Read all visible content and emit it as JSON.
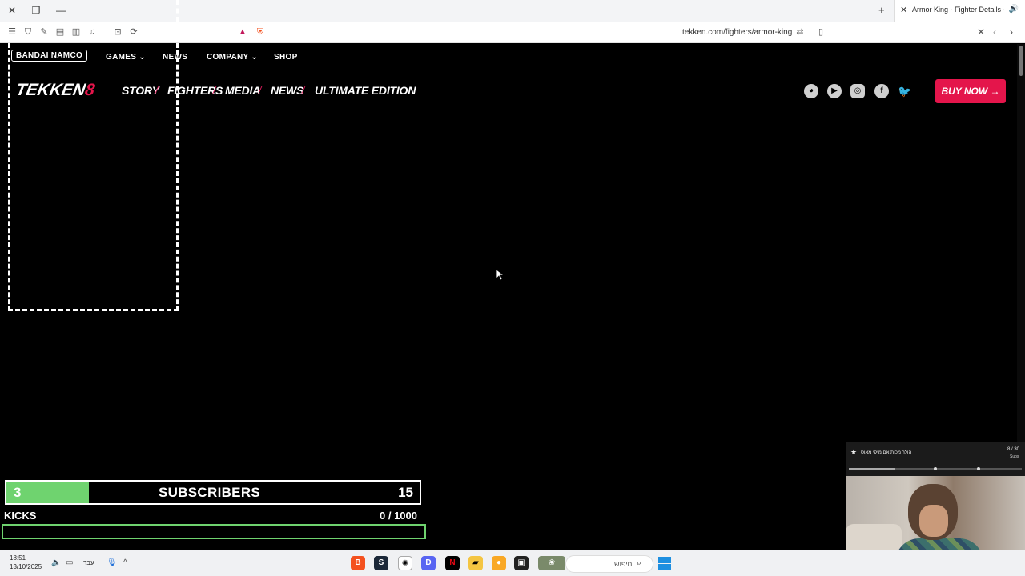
{
  "browser": {
    "tab_title": "Armor King - Fighter Details - TE",
    "url": "tekken.com/fighters/armor-king"
  },
  "site": {
    "publisher_logo": "BANDAI NAMCO",
    "top_nav": [
      "GAMES",
      "NEWS",
      "COMPANY",
      "SHOP"
    ],
    "logo_text": "TEKKEN",
    "logo_number": "8",
    "main_nav": [
      "STORY",
      "FIGHTERS",
      "MEDIA",
      "NEWS",
      "ULTIMATE EDITION"
    ],
    "social": [
      "discord-icon",
      "youtube-icon",
      "instagram-icon",
      "facebook-icon",
      "twitter-icon"
    ],
    "buy_label": "BUY NOW →"
  },
  "overlay": {
    "sub_left": "3",
    "sub_label": "SUBSCRIBERS",
    "sub_right": "15",
    "sub_progress": 0.2,
    "kicks_label": "KICKS",
    "kicks_count": "0  / 1000",
    "kicks_progress": 0,
    "goal_title": "הולך מכות אם מיקי מאוס",
    "goal_count": "8 / 30",
    "goal_unit": "Subs",
    "goal_progress": 0.27
  },
  "taskbar": {
    "time": "18:51",
    "date": "13/10/2025",
    "lang": "עבר",
    "search_placeholder": "חיפוש"
  },
  "colors": {
    "accent": "#e4154b",
    "progress_green": "#6fd36f"
  }
}
